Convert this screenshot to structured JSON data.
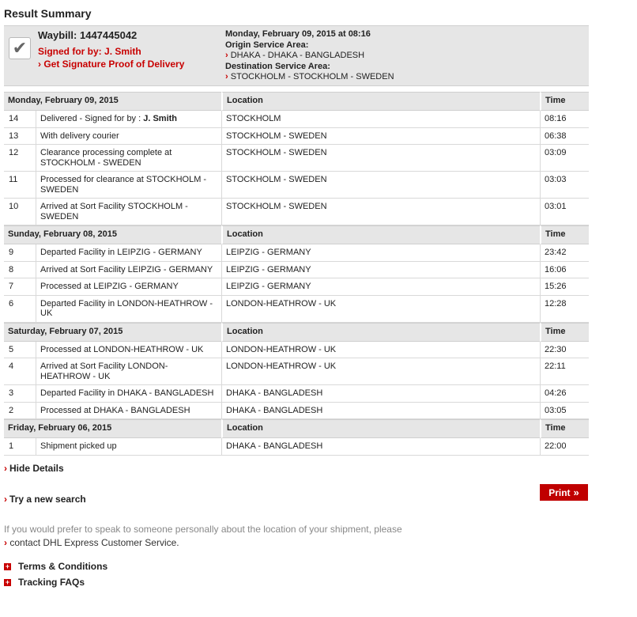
{
  "title": "Result Summary",
  "summary": {
    "waybill_label": "Waybill:",
    "waybill_number": "1447445042",
    "signed_label": "Signed for by:",
    "signed_name": "J. Smith",
    "proof_link": "Get Signature Proof of Delivery",
    "datetime": "Monday, February 09, 2015 at 08:16",
    "origin_label": "Origin Service Area:",
    "origin": "DHAKA - DHAKA - BANGLADESH",
    "destination_label": "Destination Service Area:",
    "destination": "STOCKHOLM - STOCKHOLM - SWEDEN"
  },
  "table": {
    "location_header": "Location",
    "time_header": "Time",
    "days": [
      {
        "date": "Monday, February 09, 2015",
        "events": [
          {
            "num": "14",
            "desc": "Delivered - Signed for by : ",
            "signed": "J. Smith",
            "location": "STOCKHOLM",
            "time": "08:16"
          },
          {
            "num": "13",
            "desc": "With delivery courier",
            "location": "STOCKHOLM - SWEDEN",
            "time": "06:38"
          },
          {
            "num": "12",
            "desc": "Clearance processing complete at STOCKHOLM - SWEDEN",
            "location": "STOCKHOLM - SWEDEN",
            "time": "03:09"
          },
          {
            "num": "11",
            "desc": "Processed for clearance at STOCKHOLM - SWEDEN",
            "location": "STOCKHOLM - SWEDEN",
            "time": "03:03"
          },
          {
            "num": "10",
            "desc": "Arrived at Sort Facility STOCKHOLM - SWEDEN",
            "location": "STOCKHOLM - SWEDEN",
            "time": "03:01"
          }
        ]
      },
      {
        "date": "Sunday, February 08, 2015",
        "events": [
          {
            "num": "9",
            "desc": "Departed Facility in LEIPZIG - GERMANY",
            "location": "LEIPZIG - GERMANY",
            "time": "23:42"
          },
          {
            "num": "8",
            "desc": "Arrived at Sort Facility LEIPZIG - GERMANY",
            "location": "LEIPZIG - GERMANY",
            "time": "16:06"
          },
          {
            "num": "7",
            "desc": "Processed at LEIPZIG - GERMANY",
            "location": "LEIPZIG - GERMANY",
            "time": "15:26"
          },
          {
            "num": "6",
            "desc": "Departed Facility in LONDON-HEATHROW - UK",
            "location": "LONDON-HEATHROW - UK",
            "time": "12:28"
          }
        ]
      },
      {
        "date": "Saturday, February 07, 2015",
        "events": [
          {
            "num": "5",
            "desc": "Processed at LONDON-HEATHROW - UK",
            "location": "LONDON-HEATHROW - UK",
            "time": "22:30"
          },
          {
            "num": "4",
            "desc": "Arrived at Sort Facility LONDON-HEATHROW - UK",
            "location": "LONDON-HEATHROW - UK",
            "time": "22:11"
          },
          {
            "num": "3",
            "desc": "Departed Facility in DHAKA - BANGLADESH",
            "location": "DHAKA - BANGLADESH",
            "time": "04:26"
          },
          {
            "num": "2",
            "desc": "Processed at DHAKA - BANGLADESH",
            "location": "DHAKA - BANGLADESH",
            "time": "03:05"
          }
        ]
      },
      {
        "date": "Friday, February 06, 2015",
        "events": [
          {
            "num": "1",
            "desc": "Shipment picked up",
            "location": "DHAKA - BANGLADESH",
            "time": "22:00"
          }
        ]
      }
    ]
  },
  "links": {
    "hide_details": "Hide Details",
    "new_search": "Try a new search",
    "print": "Print",
    "contact_text": "If you would prefer to speak to someone personally about the location of your shipment, please",
    "contact_link": "contact  DHL Express Customer Service.",
    "terms": "Terms & Conditions",
    "faqs": "Tracking FAQs"
  },
  "icons": {
    "check": "checkmark-icon",
    "arrow": "red-chevron-icon",
    "plus": "plus-icon",
    "print_chevron": "double-chevron-icon"
  },
  "colors": {
    "accent": "#c80000",
    "header_bg": "#e6e6e6"
  }
}
